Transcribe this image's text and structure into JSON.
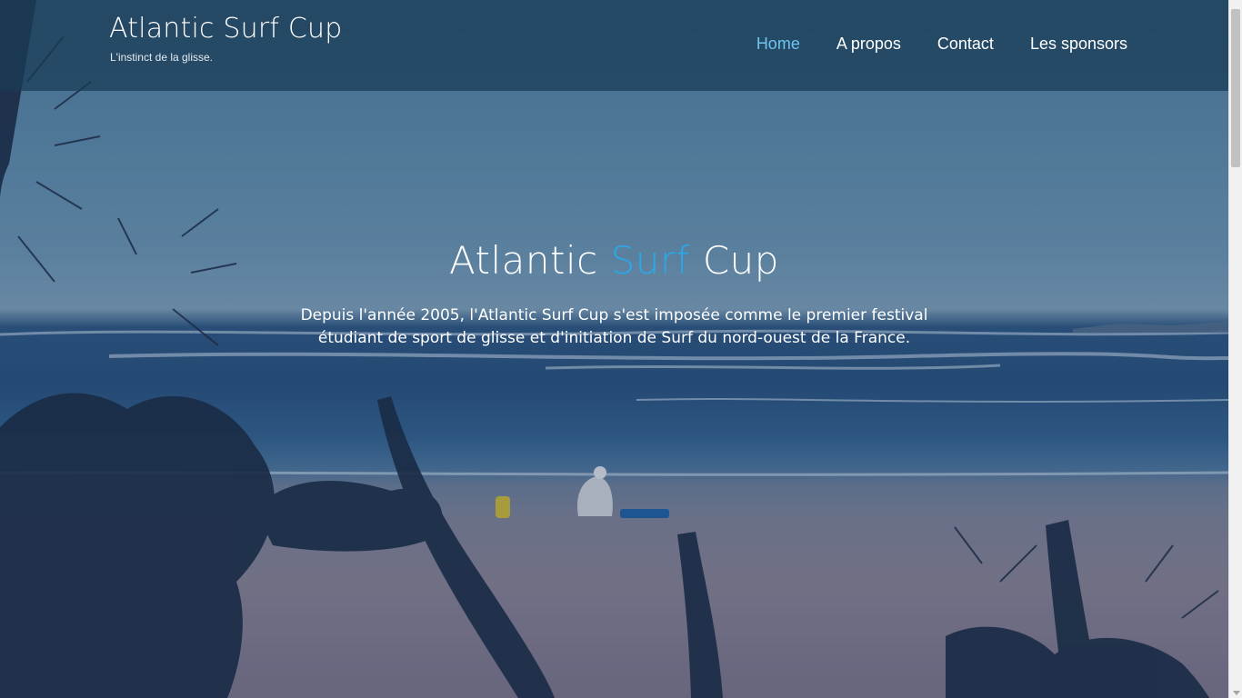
{
  "header": {
    "site_title": "Atlantic Surf Cup",
    "tagline": "L'instinct de la glisse."
  },
  "nav": {
    "items": [
      {
        "label": "Home",
        "active": true
      },
      {
        "label": "A propos",
        "active": false
      },
      {
        "label": "Contact",
        "active": false
      },
      {
        "label": "Les sponsors",
        "active": false
      }
    ]
  },
  "hero": {
    "title_part1": "Atlantic ",
    "title_accent": "Surf",
    "title_part2": " Cup",
    "description": "Depuis l'année 2005, l'Atlantic Surf Cup s'est imposée comme le premier festival étudiant de sport de glisse et d'initiation de Surf du nord-ouest de la France."
  },
  "colors": {
    "accent": "#2aa9e8",
    "nav_active": "#6fc4ef",
    "header_bg": "#193c55"
  },
  "icons": {
    "scroll_down": "chevron-down-icon"
  }
}
